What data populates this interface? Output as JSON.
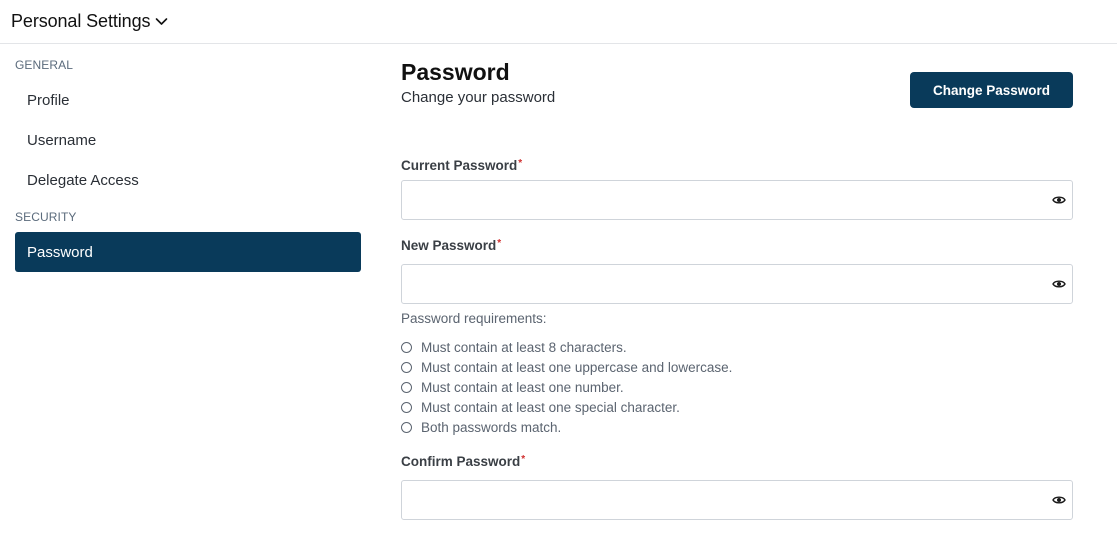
{
  "header": {
    "title": "Personal Settings"
  },
  "sidebar": {
    "sections": [
      {
        "label": "GENERAL",
        "items": [
          {
            "label": "Profile"
          },
          {
            "label": "Username"
          },
          {
            "label": "Delegate Access"
          }
        ]
      },
      {
        "label": "SECURITY",
        "items": [
          {
            "label": "Password",
            "active": true
          }
        ]
      }
    ]
  },
  "main": {
    "title": "Password",
    "subtitle": "Change your password",
    "change_button": "Change Password",
    "fields": {
      "current": {
        "label": "Current Password",
        "required_mark": "*",
        "value": ""
      },
      "new": {
        "label": "New Password",
        "required_mark": "*",
        "value": ""
      },
      "confirm": {
        "label": "Confirm Password",
        "required_mark": "*",
        "value": ""
      }
    },
    "requirements": {
      "title": "Password requirements:",
      "items": [
        "Must contain at least 8 characters.",
        "Must contain at least one uppercase and lowercase.",
        "Must contain at least one number.",
        "Must contain at least one special character.",
        "Both passwords match."
      ]
    }
  },
  "colors": {
    "accent": "#093a5a",
    "required": "#d0302f"
  },
  "icons": {
    "title_dropdown": "chevron-down-icon",
    "show_password": "eye-icon",
    "requirement_status": "empty-circle-icon"
  }
}
